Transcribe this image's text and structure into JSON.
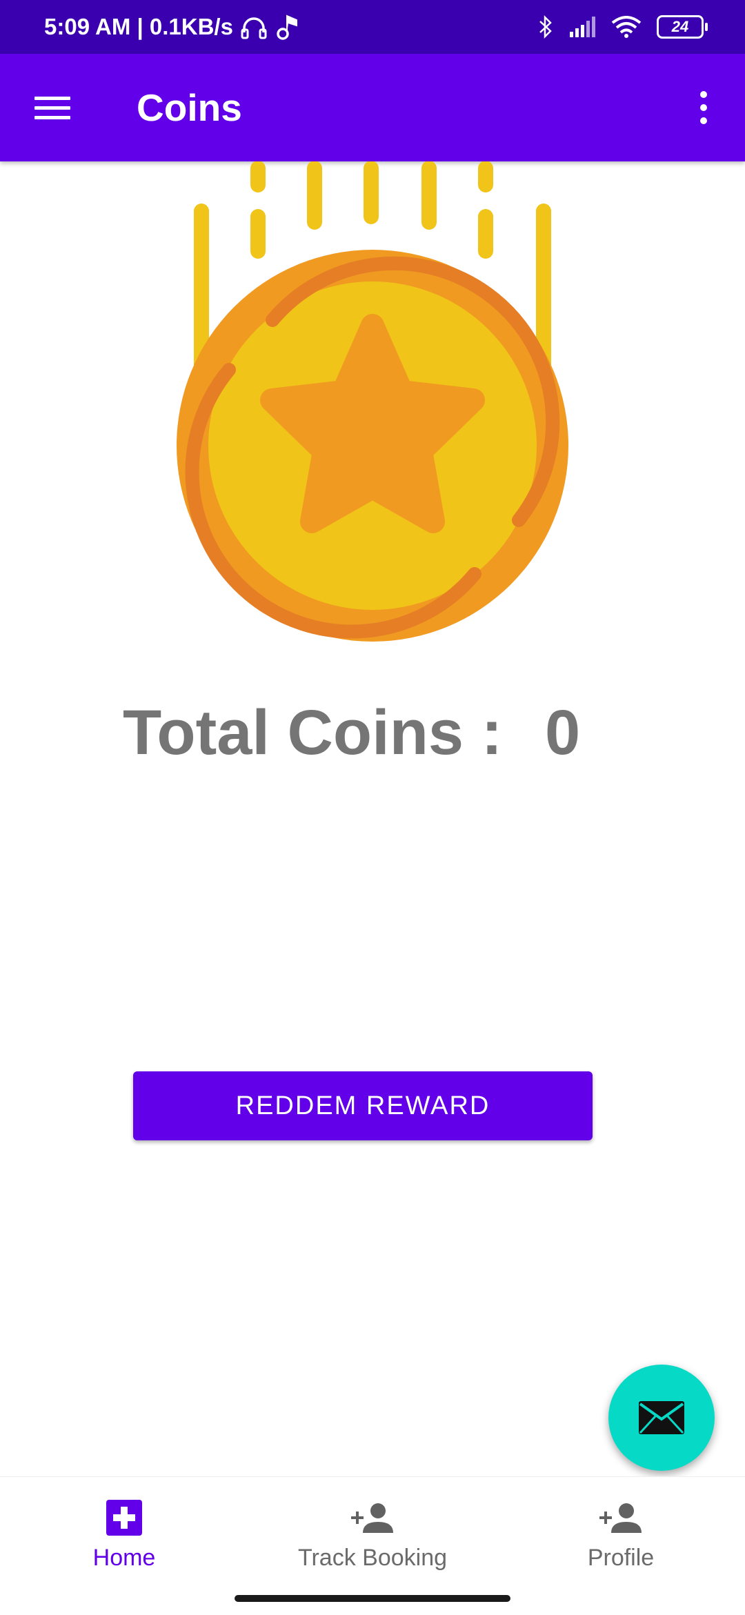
{
  "status_bar": {
    "time": "5:09 AM | 0.1KB/s",
    "battery": "24"
  },
  "app_bar": {
    "title": "Coins"
  },
  "coins": {
    "label": "Total Coins :",
    "value": "0"
  },
  "redeem_button": {
    "label": "REDDEM REWARD"
  },
  "bottom_nav": {
    "items": [
      {
        "label": "Home",
        "icon": "medical-cross-icon",
        "active": true
      },
      {
        "label": "Track Booking",
        "icon": "person-add-icon",
        "active": false
      },
      {
        "label": "Profile",
        "icon": "person-add-icon",
        "active": false
      }
    ]
  },
  "colors": {
    "status_bar": "#3a00b0",
    "primary": "#6200ea",
    "fab": "#06dac6",
    "coin_outer": "#f19a22",
    "coin_inner": "#f0c419",
    "coin_ring": "#e57e25",
    "text_gray": "#757575"
  }
}
